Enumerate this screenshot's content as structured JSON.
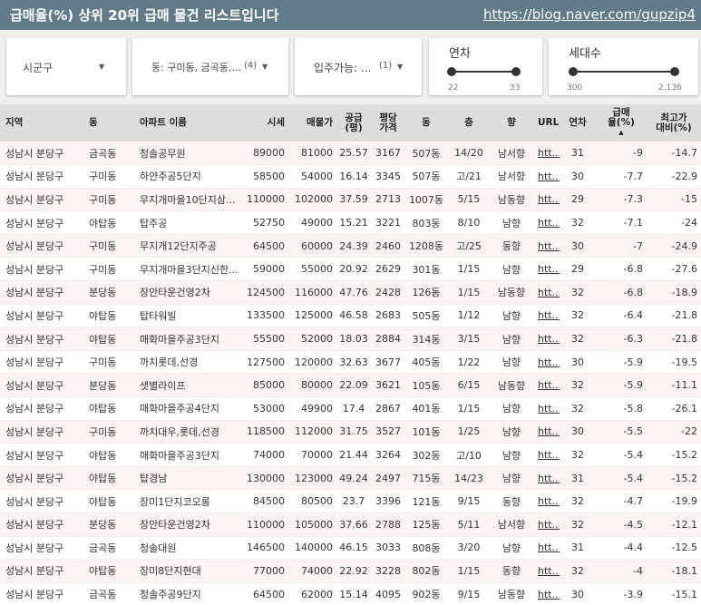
{
  "header": {
    "title": "급매율(%) 상위 20위 급매 물건 리스트입니다",
    "url": "https://blog.naver.com/gupzip4"
  },
  "filters": {
    "sigungu": "시군구",
    "dong": "동: 구미동, 금곡동,...",
    "dong_count": "(4)",
    "ready": "입주가능: ...",
    "ready_count": "(1)",
    "year_title": "연차",
    "year_min": "22",
    "year_max": "33",
    "households_title": "세대수",
    "households_min": "300",
    "households_max": "2,136"
  },
  "table": {
    "headers": [
      "지역",
      "동",
      "아파트 이름",
      "시세",
      "매물가",
      "공급\n(평)",
      "평당\n가격",
      "동",
      "층",
      "향",
      "URL",
      "연차",
      "급매\n율(%)",
      "최고가\n대비(%)"
    ],
    "rows": [
      [
        "성남시 분당구",
        "금곡동",
        "청솔공무원",
        "89000",
        "81000",
        "25.57",
        "3167",
        "507동",
        "14/20",
        "남서향",
        "htt...",
        "31",
        "-9",
        "-14.7"
      ],
      [
        "성남시 분당구",
        "구미동",
        "하얀주공5단지",
        "58500",
        "54000",
        "16.14",
        "3345",
        "507동",
        "고/21",
        "남서향",
        "htt...",
        "30",
        "-7.7",
        "-22.9"
      ],
      [
        "성남시 분당구",
        "구미동",
        "무지개마을10단지삼...",
        "110000",
        "102000",
        "37.59",
        "2713",
        "1007동",
        "5/15",
        "남동향",
        "htt...",
        "29",
        "-7.3",
        "-15"
      ],
      [
        "성남시 분당구",
        "야탑동",
        "탑주공",
        "52750",
        "49000",
        "15.21",
        "3221",
        "803동",
        "8/10",
        "남향",
        "htt...",
        "32",
        "-7.1",
        "-24"
      ],
      [
        "성남시 분당구",
        "구미동",
        "무지개12단지주공",
        "64500",
        "60000",
        "24.39",
        "2460",
        "1208동",
        "고/25",
        "동향",
        "htt...",
        "30",
        "-7",
        "-24.9"
      ],
      [
        "성남시 분당구",
        "구미동",
        "무지개마을3단지신한...",
        "59000",
        "55000",
        "20.92",
        "2629",
        "301동",
        "1/15",
        "남향",
        "htt...",
        "29",
        "-6.8",
        "-27.6"
      ],
      [
        "성남시 분당구",
        "분당동",
        "장안타운건영2차",
        "124500",
        "116000",
        "47.76",
        "2428",
        "126동",
        "1/15",
        "남동향",
        "htt...",
        "32",
        "-6.8",
        "-18.9"
      ],
      [
        "성남시 분당구",
        "야탑동",
        "탑타워빌",
        "133500",
        "125000",
        "46.58",
        "2683",
        "505동",
        "1/12",
        "남향",
        "htt...",
        "32",
        "-6.4",
        "-21.8"
      ],
      [
        "성남시 분당구",
        "야탑동",
        "매화마을주공3단지",
        "55500",
        "52000",
        "18.03",
        "2884",
        "314동",
        "3/15",
        "남향",
        "htt...",
        "32",
        "-6.3",
        "-21.8"
      ],
      [
        "성남시 분당구",
        "구미동",
        "까치롯데,선경",
        "127500",
        "120000",
        "32.63",
        "3677",
        "405동",
        "1/22",
        "남향",
        "htt...",
        "30",
        "-5.9",
        "-19.5"
      ],
      [
        "성남시 분당구",
        "분당동",
        "샛별라이프",
        "85000",
        "80000",
        "22.09",
        "3621",
        "105동",
        "6/15",
        "남동향",
        "htt...",
        "32",
        "-5.9",
        "-11.1"
      ],
      [
        "성남시 분당구",
        "야탑동",
        "매화마을주공4단지",
        "53000",
        "49900",
        "17.4",
        "2867",
        "401동",
        "1/15",
        "남향",
        "htt...",
        "32",
        "-5.8",
        "-26.1"
      ],
      [
        "성남시 분당구",
        "구미동",
        "까치대우,롯데,선경",
        "118500",
        "112000",
        "31.75",
        "3527",
        "101동",
        "1/25",
        "남향",
        "htt...",
        "30",
        "-5.5",
        "-22"
      ],
      [
        "성남시 분당구",
        "야탑동",
        "매화마을주공3단지",
        "74000",
        "70000",
        "21.44",
        "3264",
        "302동",
        "고/10",
        "남향",
        "htt...",
        "32",
        "-5.4",
        "-15.2"
      ],
      [
        "성남시 분당구",
        "야탑동",
        "탑경남",
        "130000",
        "123000",
        "49.24",
        "2497",
        "715동",
        "14/23",
        "남향",
        "htt...",
        "31",
        "-5.4",
        "-15.2"
      ],
      [
        "성남시 분당구",
        "야탑동",
        "장미1단지코오롱",
        "84500",
        "80500",
        "23.7",
        "3396",
        "121동",
        "9/15",
        "동향",
        "htt...",
        "32",
        "-4.7",
        "-19.9"
      ],
      [
        "성남시 분당구",
        "분당동",
        "장안타운건영2차",
        "110000",
        "105000",
        "37.66",
        "2788",
        "125동",
        "5/11",
        "남서향",
        "htt...",
        "32",
        "-4.5",
        "-12.1"
      ],
      [
        "성남시 분당구",
        "금곡동",
        "청솔대원",
        "146500",
        "140000",
        "46.15",
        "3033",
        "808동",
        "3/20",
        "남향",
        "htt...",
        "31",
        "-4.4",
        "-12.5"
      ],
      [
        "성남시 분당구",
        "야탑동",
        "장미8단지현대",
        "77000",
        "74000",
        "22.92",
        "3228",
        "802동",
        "1/15",
        "동향",
        "htt...",
        "32",
        "-4",
        "-18.1"
      ],
      [
        "성남시 분당구",
        "금곡동",
        "청솔주공9단지",
        "64500",
        "62000",
        "15.14",
        "4095",
        "902동",
        "9/15",
        "남동향",
        "htt...",
        "30",
        "-3.9",
        "-15.1"
      ]
    ]
  }
}
